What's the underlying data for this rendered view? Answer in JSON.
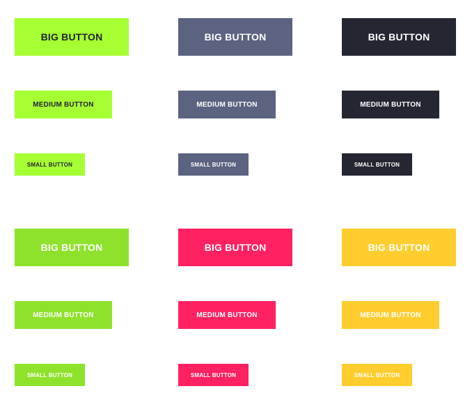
{
  "labels": {
    "big": "BIG BUTTON",
    "medium": "MEDIUM BUTTON",
    "small": "SMALL BUTTON"
  },
  "colors": {
    "lime": "#a6ff33",
    "slate": "#5c6380",
    "dark": "#242631",
    "green": "#8fe22b",
    "pink": "#ff2161",
    "yellow": "#ffcd2e",
    "dark_text": "#1f2330",
    "light_text": "#ffffff"
  }
}
